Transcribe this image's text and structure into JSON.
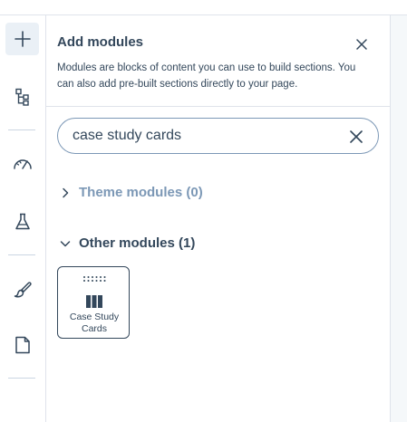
{
  "rail": {
    "items": [
      {
        "icon": "plus-icon",
        "active": true
      },
      {
        "icon": "tree-structure-icon",
        "active": false
      },
      {
        "icon": "gauge-icon",
        "active": false
      },
      {
        "icon": "flask-icon",
        "active": false
      },
      {
        "icon": "paintbrush-icon",
        "active": false
      },
      {
        "icon": "page-icon",
        "active": false
      }
    ]
  },
  "panel": {
    "title": "Add modules",
    "description": "Modules are blocks of content you can use to build sections. You can also add pre-built sections directly to your page.",
    "close_icon": "close-icon"
  },
  "search": {
    "value": "case study cards",
    "clear_icon": "close-icon"
  },
  "sections": {
    "theme": {
      "label": "Theme modules (0)",
      "expanded": false
    },
    "other": {
      "label": "Other modules (1)",
      "expanded": true
    }
  },
  "modules": [
    {
      "label": "Case Study Cards",
      "icon": "columns-icon"
    }
  ],
  "colors": {
    "text": "#33475b",
    "muted": "#7c98b6",
    "border": "#dfe3eb",
    "active_bg": "#eaf0f6"
  }
}
